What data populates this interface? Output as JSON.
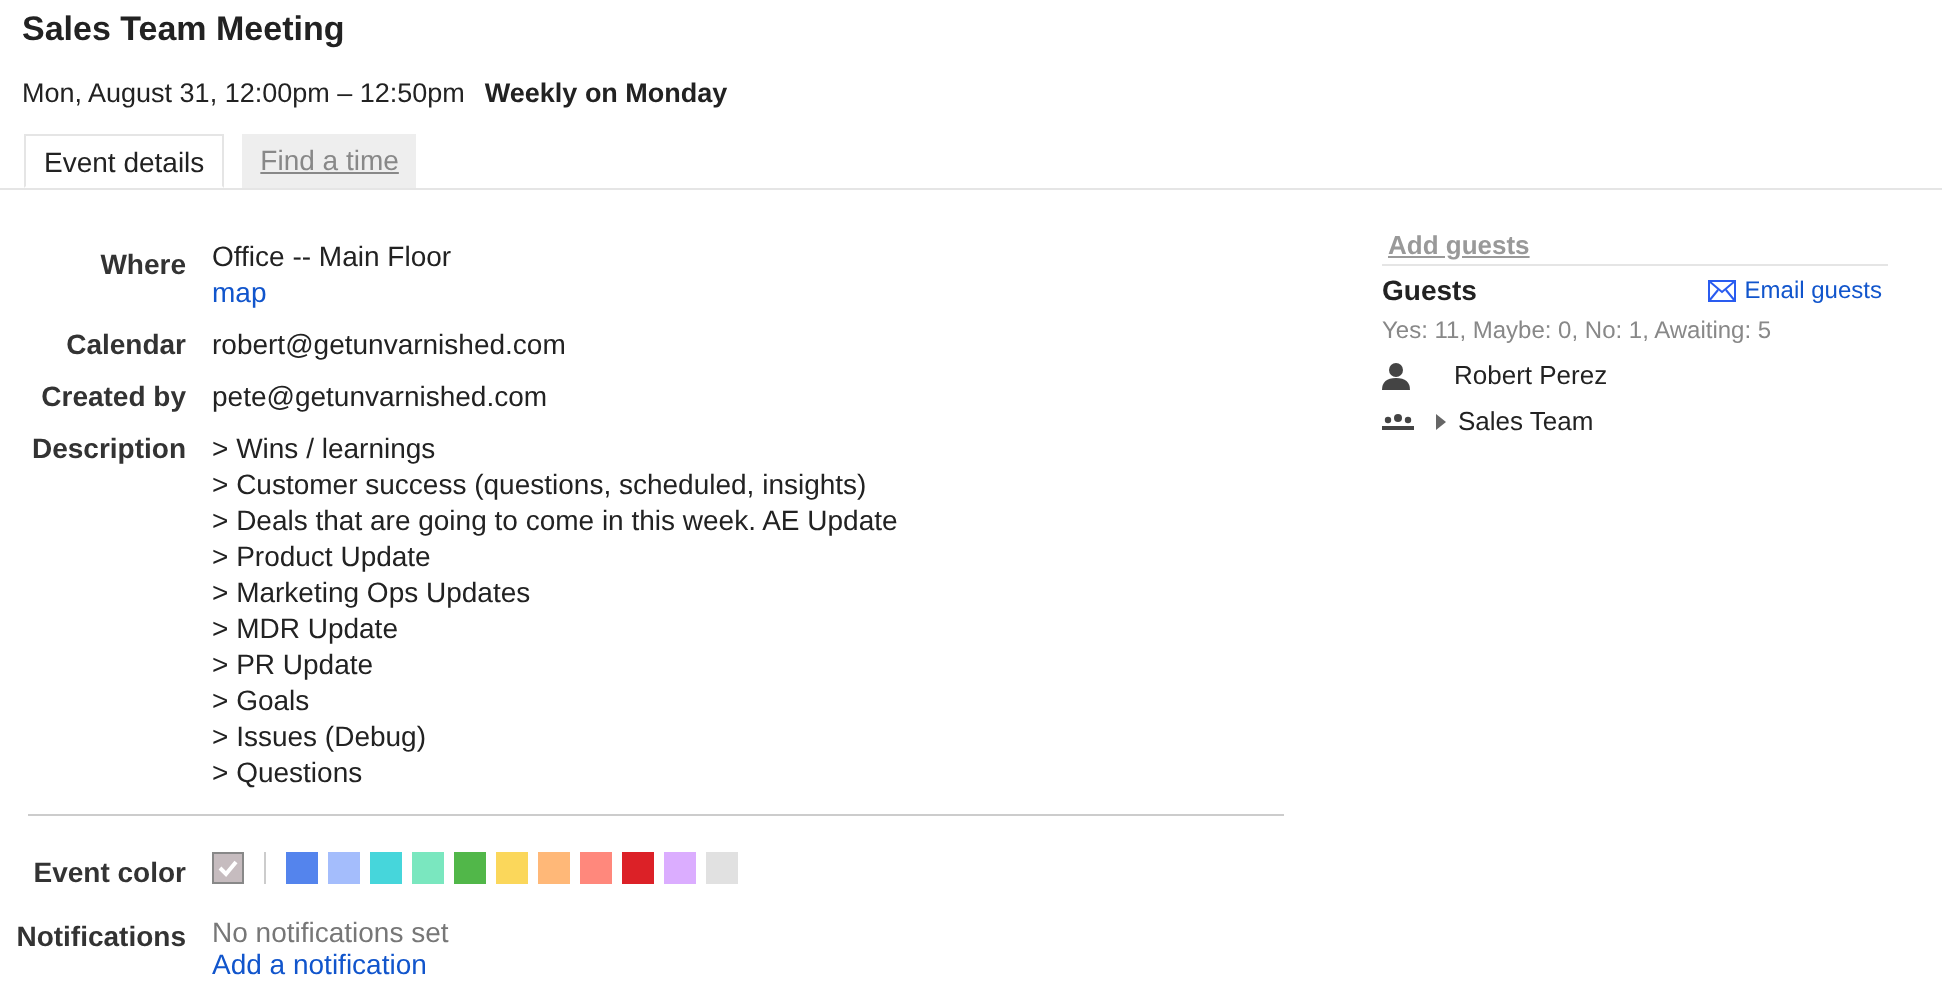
{
  "event": {
    "title": "Sales Team Meeting",
    "when": "Mon, August 31, 12:00pm – 12:50pm",
    "recurrence": "Weekly on Monday"
  },
  "tabs": [
    {
      "label": "Event details",
      "selected": true
    },
    {
      "label": "Find a time",
      "selected": false
    }
  ],
  "details": {
    "where_label": "Where",
    "where": "Office -- Main Floor",
    "map_link": "map",
    "calendar_label": "Calendar",
    "calendar": "robert@getunvarnished.com",
    "created_by_label": "Created by",
    "created_by": "pete@getunvarnished.com",
    "description_label": "Description",
    "description": [
      "> Wins / learnings",
      "> Customer success (questions, scheduled, insights)",
      "> Deals that are going to come in this week. AE Update",
      "> Product Update",
      "> Marketing Ops Updates",
      "> MDR Update",
      "> PR Update",
      "> Goals",
      "> Issues (Debug)",
      "> Questions"
    ]
  },
  "event_color": {
    "label": "Event color",
    "swatches": [
      {
        "color": "#c6bcbf",
        "selected": true
      },
      {
        "color": "#5484ed",
        "selected": false
      },
      {
        "color": "#a4bdfc",
        "selected": false
      },
      {
        "color": "#46d6db",
        "selected": false
      },
      {
        "color": "#7ae7bf",
        "selected": false
      },
      {
        "color": "#51b749",
        "selected": false
      },
      {
        "color": "#fbd75b",
        "selected": false
      },
      {
        "color": "#ffb878",
        "selected": false
      },
      {
        "color": "#ff887c",
        "selected": false
      },
      {
        "color": "#dc2127",
        "selected": false
      },
      {
        "color": "#dbadff",
        "selected": false
      },
      {
        "color": "#e1e1e1",
        "selected": false
      }
    ]
  },
  "notifications": {
    "label": "Notifications",
    "status": "No notifications set",
    "add_link": "Add a notification"
  },
  "guests": {
    "add_guests": "Add guests",
    "title": "Guests",
    "email_link": "Email guests",
    "summary": "Yes: 11, Maybe: 0, No: 1, Awaiting: 5",
    "list": [
      {
        "kind": "person",
        "name": "Robert Perez"
      },
      {
        "kind": "group",
        "name": "Sales Team",
        "expanded": false
      }
    ]
  }
}
